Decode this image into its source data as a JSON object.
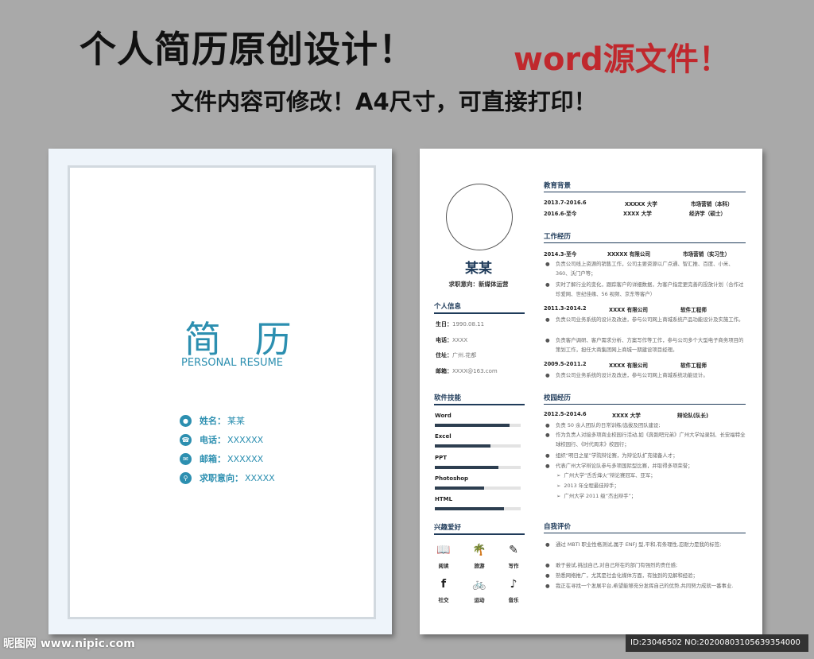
{
  "banner": {
    "title": "个人简历原创设计！",
    "title_red": "word源文件！",
    "subtitle": "文件内容可修改！A4尺寸，可直接打印！"
  },
  "cover": {
    "title": "简 历",
    "subtitle": "PERSONAL RESUME",
    "items": [
      {
        "icon": "person-icon",
        "label": "姓名：",
        "value": "某某"
      },
      {
        "icon": "phone-icon",
        "label": "电话：",
        "value": "XXXXXX"
      },
      {
        "icon": "mail-icon",
        "label": "邮箱：",
        "value": "XXXXXX"
      },
      {
        "icon": "search-icon",
        "label": "求职意向：",
        "value": "XXXXX"
      }
    ]
  },
  "resume": {
    "name": "某某",
    "intent": "求职意向：新媒体运营",
    "personal": {
      "title": "个人信息",
      "items": [
        {
          "label": "生日：",
          "value": "1990.08.11"
        },
        {
          "label": "电话：",
          "value": "XXXX"
        },
        {
          "label": "住址：",
          "value": "广州.花都"
        },
        {
          "label": "邮箱：",
          "value": "XXXX@163.com"
        }
      ]
    },
    "skills": {
      "title": "软件技能",
      "items": [
        {
          "name": "Word",
          "level": 0.87
        },
        {
          "name": "Excel",
          "level": 0.65
        },
        {
          "name": "PPT",
          "level": 0.74
        },
        {
          "name": "Photoshop",
          "level": 0.57
        },
        {
          "name": "HTML",
          "level": 0.81
        }
      ]
    },
    "hobbies": {
      "title": "兴趣爱好",
      "items": [
        {
          "icon": "book-icon",
          "label": "阅读"
        },
        {
          "icon": "palm-tree-icon",
          "label": "旅游"
        },
        {
          "icon": "pen-icon",
          "label": "写作"
        },
        {
          "icon": "facebook-icon",
          "label": "社交"
        },
        {
          "icon": "bicycle-icon",
          "label": "运动"
        },
        {
          "icon": "music-note-icon",
          "label": "音乐"
        }
      ]
    },
    "education": {
      "title": "教育背景",
      "rows": [
        {
          "date": "2013.7-2016.6",
          "org": "XXXXX 大学",
          "role": "市场营销（本科）"
        },
        {
          "date": "2016.6-至今",
          "org": "XXXX 大学",
          "role": "经济学（硕士）"
        }
      ]
    },
    "work": {
      "title": "工作经历",
      "jobs": [
        {
          "date": "2014.3-至今",
          "org": "XXXXX 有限公司",
          "role": "市场营销（实习生）",
          "bullets": [
            "负责公司线上资源的销售工作，公司主要资源以广点通、智汇推、百度、小米、360、沃门户等；",
            "实时了解行业的变化，跟踪客户的详细数据，为客户指定更完善的投放计划（合作过珍爱网、世纪佳缘、56 视频、京东等客户）"
          ]
        },
        {
          "date": "2011.3-2014.2",
          "org": "XXXX 有限公司",
          "role": "软件工程师",
          "bullets": [
            "负责公司业务系统的设计及改进，参与公司网上商城系统产品功能设计及实施工作。",
            "负责客户调研、客户需求分析、方案写作等工作，参与公司多个大型电子商务项目的策划工作，担任大商集团网上商城一期建设项目经理。"
          ]
        },
        {
          "date": "2009.5-2011.2",
          "org": "XXXX 有限公司",
          "role": "软件工程师",
          "bullets": [
            "负责公司业务系统的设计及改进，参与公司网上商城系统功能设计。"
          ]
        }
      ]
    },
    "campus": {
      "title": "校园经历",
      "date": "2012.5-2014.6",
      "org": "XXXX 大学",
      "role": "辩论队(队长)",
      "bullets": [
        "负责 50 余人团队的日常训练/选拔及团队建设;",
        "作为负责人对接多项商业校园行活动,如《奔跑吧兄弟》广州大学站录制、长安福特全球校园行、《时代周末》校园行；",
        "组织“明日之星”学院辩论赛，为辩论队扩充储备人才；",
        "代表广州大学辩论队参与多项国际型比赛，并取得多项荣誉；"
      ],
      "awards": [
        "广州大学“舌舌烽火”辩论赛冠军、亚军；",
        "2013 年全程最佳辩手；",
        "广州大学 2011 级“杰出辩手”；"
      ]
    },
    "self_eval": {
      "title": "自我评价",
      "bullets": [
        "通过 MBTI 职业性格测试,属于 ENFJ 型,平和,有条理性,忍耐力是我的标签;",
        "敢于尝试,挑战自己,对自己所在的部门有强烈的责任感;",
        "熟悉网络推广，尤其是社会化媒体方面，有独到的见解和经验；",
        "我正在寻找一个发展平台,希望能够充分发挥自己的优势,共同努力成就一番事业."
      ]
    }
  },
  "watermark": {
    "left": "昵图网 www.nipic.com",
    "right": "ID:23046502 NO:20200803105639354000"
  }
}
